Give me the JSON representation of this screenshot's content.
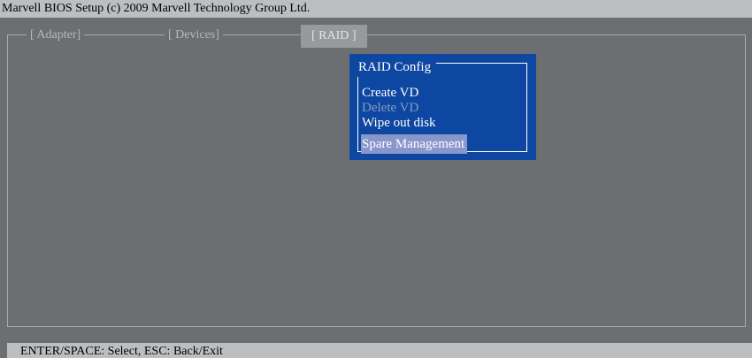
{
  "title_bar": {
    "text": "Marvell BIOS Setup (c) 2009 Marvell Technology Group Ltd."
  },
  "tabs": [
    {
      "label": "[ Adapter]",
      "active": false
    },
    {
      "label": "[ Devices]",
      "active": false
    },
    {
      "label": "[ RAID ]",
      "active": true
    }
  ],
  "dialog": {
    "title": "RAID Config",
    "items": [
      {
        "label": "Create VD",
        "state": "enabled"
      },
      {
        "label": "Delete VD",
        "state": "disabled"
      },
      {
        "label": "Wipe out disk",
        "state": "enabled"
      },
      {
        "label": "Spare Management",
        "state": "selected"
      }
    ]
  },
  "status_bar": {
    "text": "ENTER/SPACE: Select, ESC: Back/Exit"
  },
  "colors": {
    "background": "#6d6e71",
    "title_bar": "#bcbec0",
    "dialog_bg": "#0d47a1",
    "highlight": "#8896cc",
    "disabled_text": "#8c9cbf"
  }
}
